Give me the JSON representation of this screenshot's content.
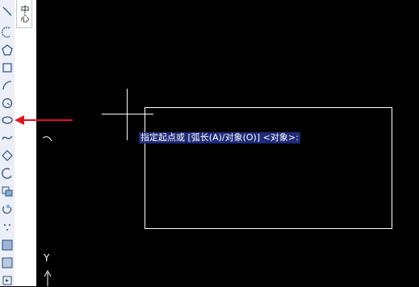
{
  "panel": {
    "tab_label": "中心"
  },
  "toolbar": {
    "tools": [
      {
        "id": "line",
        "icon": "line-icon"
      },
      {
        "id": "polyline",
        "icon": "polyline-icon"
      },
      {
        "id": "polygon",
        "icon": "polygon-icon"
      },
      {
        "id": "rectangle",
        "icon": "rectangle-icon"
      },
      {
        "id": "arc",
        "icon": "arc-icon"
      },
      {
        "id": "circle",
        "icon": "circle-icon"
      },
      {
        "id": "ellipse",
        "icon": "ellipse-icon"
      },
      {
        "id": "spline",
        "icon": "spline-icon"
      },
      {
        "id": "revcloud",
        "icon": "revision-cloud-icon"
      },
      {
        "id": "ellipse-arc",
        "icon": "ellipse-arc-icon"
      },
      {
        "id": "insert-block",
        "icon": "insert-block-icon"
      },
      {
        "id": "make-block",
        "icon": "make-block-icon"
      },
      {
        "id": "point",
        "icon": "point-icon"
      },
      {
        "id": "hatch",
        "icon": "hatch-icon"
      },
      {
        "id": "gradient",
        "icon": "gradient-icon"
      },
      {
        "id": "region",
        "icon": "region-icon"
      }
    ]
  },
  "command": {
    "prompt": "指定起点或 [弧长(A)/对象(O)] <对象>:"
  },
  "ucs": {
    "y_label": "Y"
  },
  "colors": {
    "highlight_arrow": "#e0141e",
    "prompt_bg": "#1f2a78"
  }
}
